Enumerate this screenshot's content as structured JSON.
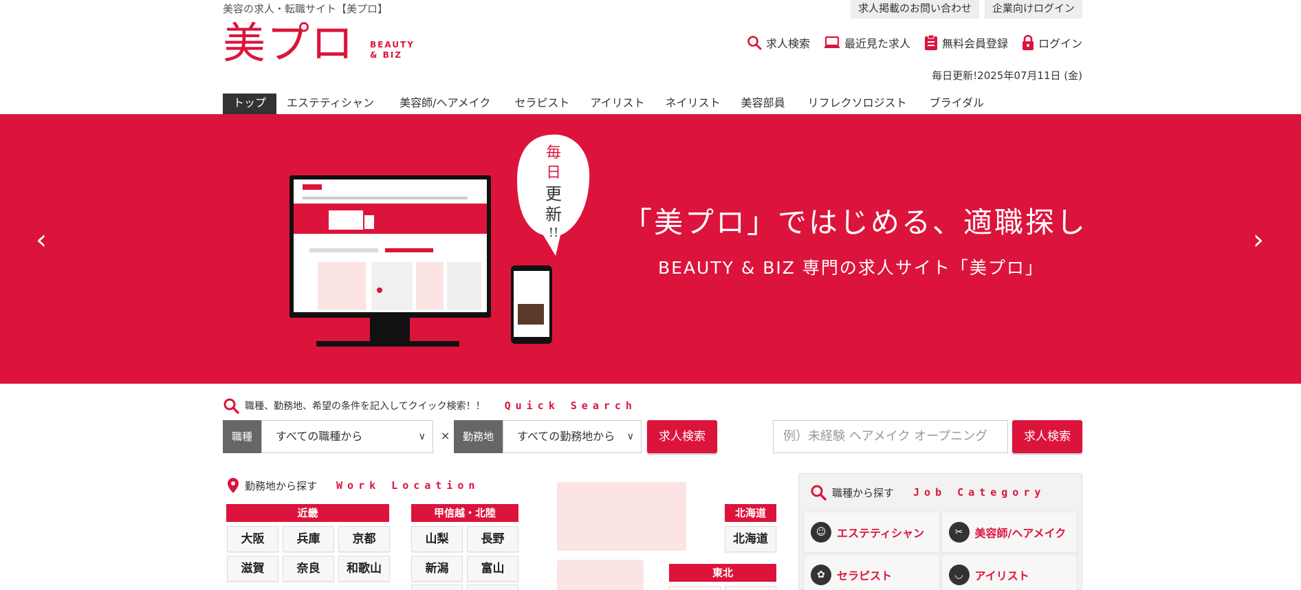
{
  "header": {
    "tagline": "美容の求人・転職サイト【美プロ】",
    "logo_jp": "美プロ",
    "logo_en_line1": "BEAUTY",
    "logo_en_line2": "& BIZ",
    "top_links": [
      "求人掲載のお問い合わせ",
      "企業向けログイン"
    ],
    "util_nav": [
      {
        "label": "求人検索",
        "icon": "search-icon"
      },
      {
        "label": "最近見た求人",
        "icon": "laptop-icon"
      },
      {
        "label": "無料会員登録",
        "icon": "clipboard-icon"
      },
      {
        "label": "ログイン",
        "icon": "lock-icon"
      }
    ],
    "date_line": "毎日更新!2025年07月11日 (金)"
  },
  "nav": {
    "tabs": [
      "トップ",
      "エステティシャン",
      "美容師/ヘアメイク",
      "セラピスト",
      "アイリスト",
      "ネイリスト",
      "美容部員",
      "リフレクソロジスト",
      "ブライダル"
    ]
  },
  "hero": {
    "title": "「美プロ」ではじめる、適職探し",
    "subtitle": "BEAUTY & BIZ 専門の求人サイト「美プロ」",
    "bubble": [
      "毎",
      "日",
      "更",
      "新",
      "!!"
    ],
    "prev": "‹",
    "next": "›"
  },
  "quick_search": {
    "description": "職種、勤務地、希望の条件を記入してクイック検索！！",
    "en_label": "Quick Search",
    "job_label": "職種",
    "job_select": "すべての職種から",
    "times": "×",
    "loc_label": "勤務地",
    "loc_select": "すべての勤務地から",
    "search_button": "求人検索",
    "keyword_placeholder": "例）未経験 ヘアメイク オープニング",
    "keyword_button": "求人検索"
  },
  "work_location": {
    "title": "勤務地から探す",
    "en_label": "Work Location",
    "kinki": {
      "name": "近畿",
      "prefs": [
        "大阪",
        "兵庫",
        "京都",
        "滋賀",
        "奈良",
        "和歌山"
      ]
    },
    "koshinetsu": {
      "name": "甲信越・北陸",
      "prefs": [
        "山梨",
        "長野",
        "新潟",
        "富山"
      ]
    },
    "hokkaido": {
      "name": "北海道",
      "prefs": [
        "北海道"
      ]
    },
    "tohoku": {
      "name": "東北"
    }
  },
  "job_category": {
    "title": "職種から探す",
    "en_label": "Job Category",
    "items": [
      "エステティシャン",
      "美容師/ヘアメイク",
      "セラピスト",
      "アイリスト"
    ]
  },
  "colors": {
    "brand": "#dc143c",
    "dark": "#333333",
    "pink": "#fce4e4"
  }
}
